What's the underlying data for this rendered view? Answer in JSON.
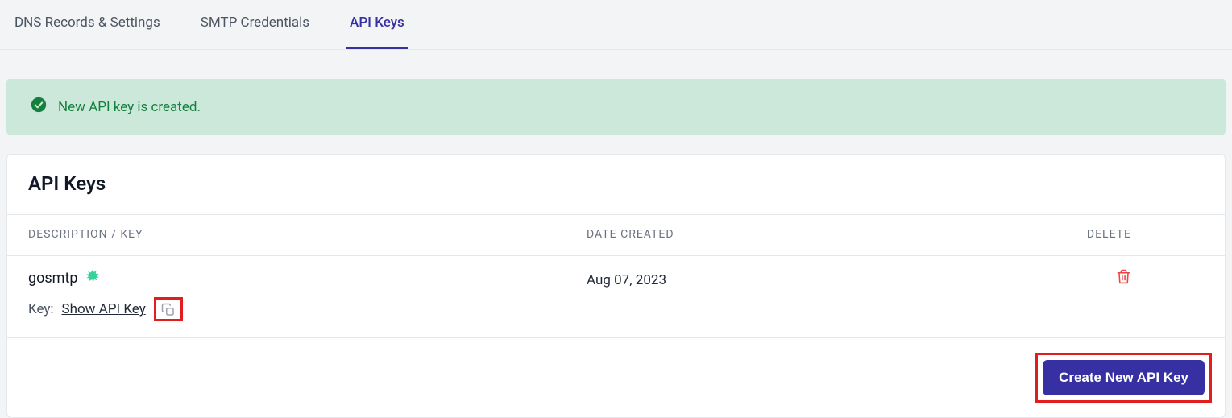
{
  "tabs": {
    "dns": "DNS Records & Settings",
    "smtp": "SMTP Credentials",
    "api": "API Keys"
  },
  "alert": {
    "text": "New API key is created."
  },
  "panel": {
    "title": "API Keys"
  },
  "columns": {
    "desc": "Description / Key",
    "date": "Date Created",
    "del": "Delete"
  },
  "row": {
    "name": "gosmtp",
    "key_label": "Key:",
    "show_link": "Show API Key",
    "date": "Aug 07, 2023"
  },
  "actions": {
    "create": "Create New API Key"
  }
}
